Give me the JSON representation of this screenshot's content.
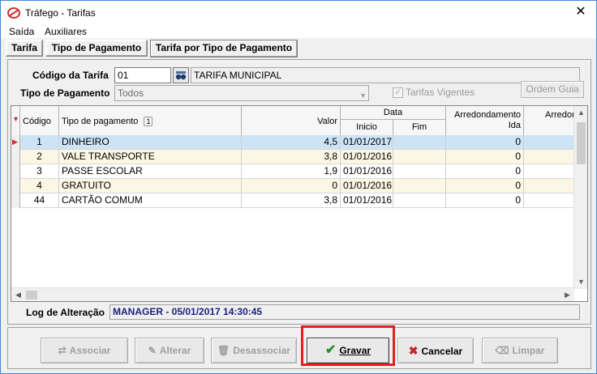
{
  "window": {
    "title": "Tráfego - Tarifas"
  },
  "menu": [
    "Saída",
    "Auxiliares"
  ],
  "tabs": [
    "Tarifa",
    "Tipo de Pagamento",
    "Tarifa por Tipo de Pagamento"
  ],
  "form": {
    "codigo_label": "Código da Tarifa",
    "codigo_value": "01",
    "tarifa_nome": "TARIFA MUNICIPAL",
    "tipo_label": "Tipo de Pagamento",
    "tipo_value": "Todos",
    "vigentes_label": "Tarifas Vigentes",
    "ordem_guia_label": "Ordem Guia"
  },
  "grid": {
    "headers": {
      "codigo": "Código",
      "tipo": "Tipo de pagamento",
      "sort_badge": "1",
      "valor": "Valor",
      "data": "Data",
      "inicio": "Inicio",
      "fim": "Fim",
      "arred_ida_1": "Arredondamento",
      "arred_ida_2": "Ida",
      "arred_volta": "Arredonc"
    },
    "rows": [
      {
        "codigo": "1",
        "tipo": "DINHEIRO",
        "valor": "4,5",
        "inicio": "01/01/2017",
        "fim": "",
        "arred": "0"
      },
      {
        "codigo": "2",
        "tipo": "VALE TRANSPORTE",
        "valor": "3,8",
        "inicio": "01/01/2016",
        "fim": "",
        "arred": "0"
      },
      {
        "codigo": "3",
        "tipo": "PASSE ESCOLAR",
        "valor": "1,9",
        "inicio": "01/01/2016",
        "fim": "",
        "arred": "0"
      },
      {
        "codigo": "4",
        "tipo": "GRATUITO",
        "valor": "0",
        "inicio": "01/01/2016",
        "fim": "",
        "arred": "0"
      },
      {
        "codigo": "44",
        "tipo": "CARTÃO COMUM",
        "valor": "3,8",
        "inicio": "01/01/2016",
        "fim": "",
        "arred": "0"
      }
    ]
  },
  "log": {
    "label": "Log de Alteração",
    "value": "MANAGER - 05/01/2017 14:30:45"
  },
  "buttons": {
    "associar": "Associar",
    "alterar": "Alterar",
    "desassociar": "Desassociar",
    "gravar": "Gravar",
    "cancelar": "Cancelar",
    "limpar": "Limpar"
  },
  "colors": {
    "selected_row": "#cde4f7",
    "alt_row": "#fcf6e4",
    "highlight": "#e32020",
    "log_text": "#1a237e"
  }
}
